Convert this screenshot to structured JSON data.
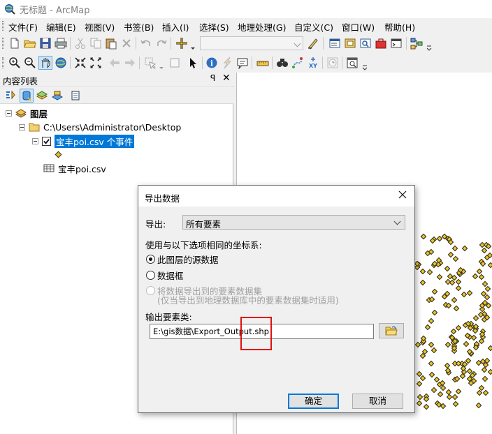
{
  "window": {
    "title": "无标题 - ArcMap",
    "app_icon": "arcmap-globe-icon"
  },
  "menu": {
    "items": [
      "文件(F)",
      "编辑(E)",
      "视图(V)",
      "书签(B)",
      "插入(I)",
      "选择(S)",
      "地理处理(G)",
      "自定义(C)",
      "窗口(W)",
      "帮助(H)"
    ]
  },
  "standard_toolbar": {
    "icons": [
      "new-document-icon",
      "open-icon",
      "save-icon",
      "print-icon",
      "cut-icon",
      "copy-icon",
      "paste-icon",
      "delete-icon",
      "undo-icon",
      "redo-icon",
      "add-data-icon",
      "editor-icon",
      "toc-window-icon",
      "catalog-icon",
      "search-window-icon",
      "arctoolbox-icon",
      "python-icon",
      "model-builder-icon"
    ],
    "scale_value": ""
  },
  "tools_toolbar": {
    "icons": [
      "zoom-in-icon",
      "zoom-out-icon",
      "pan-icon",
      "full-extent-icon",
      "fixed-zoom-in-icon",
      "fixed-zoom-out-icon",
      "back-icon",
      "forward-icon",
      "select-features-icon",
      "select-elements-icon",
      "identify-icon",
      "hyperlink-icon",
      "html-popup-icon",
      "measure-icon",
      "find-icon",
      "find-route-icon",
      "goto-xy-icon",
      "time-slider-icon",
      "viewer-window-icon"
    ]
  },
  "toc": {
    "title": "内容列表",
    "pin_glyph": "ꟼ",
    "close_glyph": "✕",
    "tool_icons": [
      "list-by-drawing-order-icon",
      "list-by-source-icon",
      "list-by-visibility-icon",
      "list-by-selection-icon",
      "options-icon"
    ],
    "tree": {
      "root_label": "图层",
      "folder_label": "C:\\Users\\Administrator\\Desktop",
      "layer_label": "宝丰poi.csv 个事件",
      "layer_checked": true,
      "table_label": "宝丰poi.csv"
    }
  },
  "dialog": {
    "title": "导出数据",
    "export_label": "导出:",
    "export_value": "所有要素",
    "coord_label": "使用与以下选项相同的坐标系:",
    "options": [
      {
        "label": "此图层的源数据",
        "checked": true,
        "disabled": false
      },
      {
        "label": "数据框",
        "checked": false,
        "disabled": false
      },
      {
        "label": "将数据导出到的要素数据集",
        "checked": false,
        "disabled": true
      }
    ],
    "option_note": "(仅当导出到地理数据库中的要素数据集时适用)",
    "output_label": "输出要素类:",
    "output_path": "E:\\gis数据\\Export_Output.shp",
    "ok_label": "确定",
    "cancel_label": "取消"
  },
  "colors": {
    "selection_blue": "#0078d7",
    "point_fill": "#e8c32a",
    "highlight_red": "#e01010"
  }
}
